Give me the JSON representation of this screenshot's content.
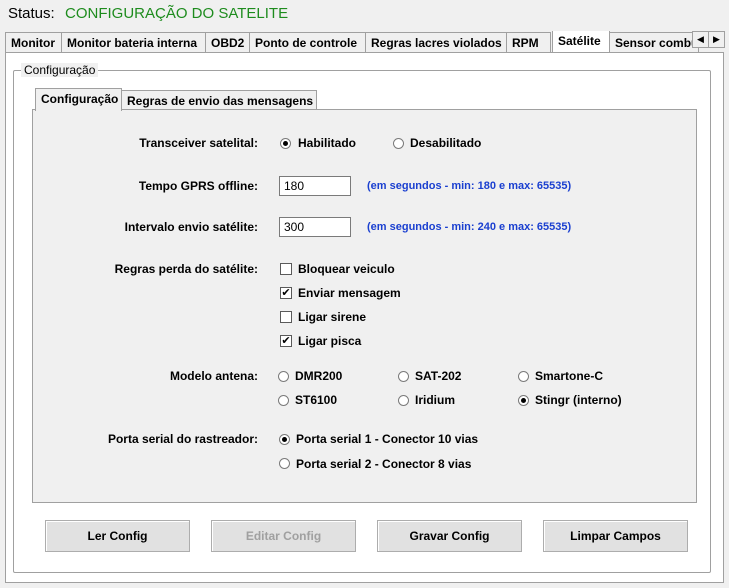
{
  "status": {
    "label": "Status:",
    "value": "CONFIGURAÇÃO DO SATELITE"
  },
  "top_tabs": [
    {
      "label": "Monitor"
    },
    {
      "label": "Monitor bateria interna"
    },
    {
      "label": "OBD2"
    },
    {
      "label": "Ponto de controle"
    },
    {
      "label": "Regras lacres violados"
    },
    {
      "label": "RPM"
    },
    {
      "label": "Satélite"
    },
    {
      "label": "Sensor combu"
    }
  ],
  "group_title": "Configuração",
  "inner_tabs": [
    {
      "label": "Configuração"
    },
    {
      "label": "Regras de envio das mensagens"
    }
  ],
  "form": {
    "transceiver": {
      "label": "Transceiver satelital:",
      "options": [
        "Habilitado",
        "Desabilitado"
      ],
      "selected": "Habilitado"
    },
    "tempo_gprs": {
      "label": "Tempo GPRS offline:",
      "value": "180",
      "hint": "(em segundos - min: 180 e max: 65535)"
    },
    "intervalo": {
      "label": "Intervalo envio satélite:",
      "value": "300",
      "hint": "(em segundos - min: 240 e max: 65535)"
    },
    "regras": {
      "label": "Regras perda do satélite:",
      "items": [
        {
          "label": "Bloquear veiculo",
          "checked": false
        },
        {
          "label": "Enviar mensagem",
          "checked": true
        },
        {
          "label": "Ligar sirene",
          "checked": false
        },
        {
          "label": "Ligar pisca",
          "checked": true
        }
      ]
    },
    "modelo": {
      "label": "Modelo antena:",
      "options": [
        "DMR200",
        "SAT-202",
        "Smartone-C",
        "ST6100",
        "Iridium",
        "Stingr (interno)"
      ],
      "selected": "Stingr (interno)"
    },
    "porta": {
      "label": "Porta serial do rastreador:",
      "options": [
        "Porta serial 1 - Conector 10 vias",
        "Porta serial 2 - Conector 8 vias"
      ],
      "selected": "Porta serial 1 - Conector 10 vias"
    }
  },
  "buttons": {
    "ler": "Ler Config",
    "editar": "Editar Config",
    "gravar": "Gravar Config",
    "limpar": "Limpar Campos"
  },
  "tab_scroll": {
    "left_icon": "triangle-left",
    "right_icon": "triangle-right"
  }
}
